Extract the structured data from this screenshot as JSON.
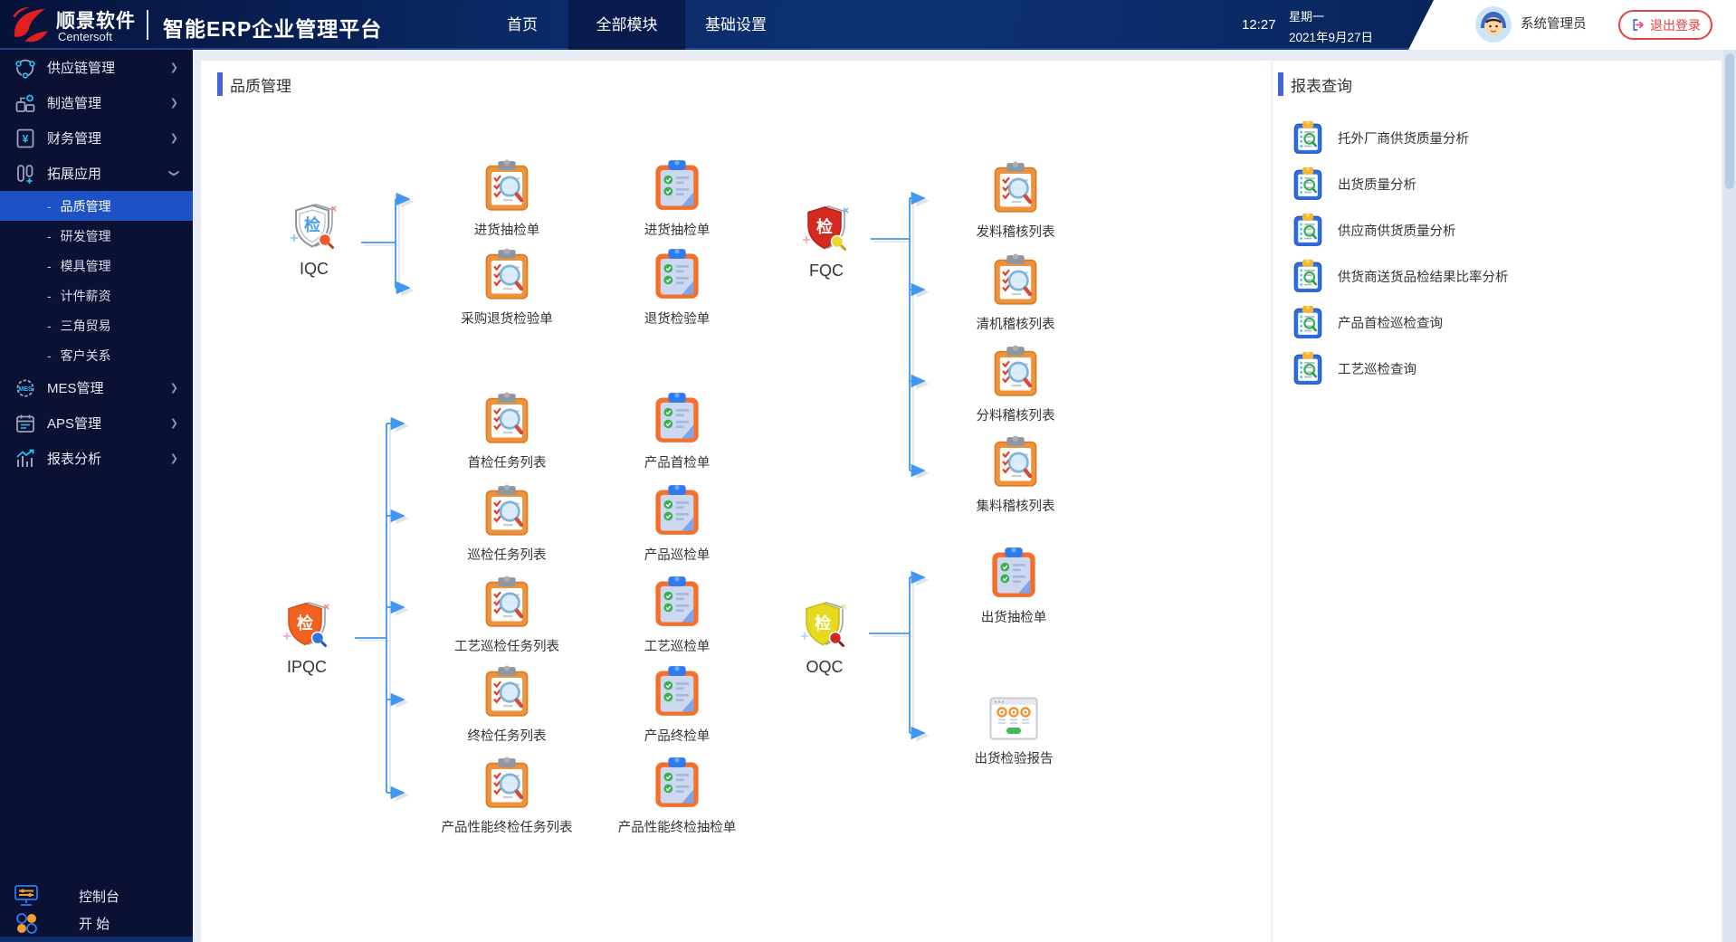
{
  "header": {
    "logo_title": "顺景软件",
    "logo_subtitle": "Centersoft",
    "app_title": "智能ERP企业管理平台",
    "nav": [
      {
        "label": "首页",
        "active": false
      },
      {
        "label": "全部模块",
        "active": true
      },
      {
        "label": "基础设置",
        "active": false
      }
    ],
    "time": "12:27",
    "weekday": "星期一",
    "date": "2021年9月27日",
    "user_name": "系统管理员",
    "logout_label": "退出登录"
  },
  "sidebar": {
    "groups_top": [
      {
        "label": "供应链管理",
        "icon": "supply-chain-icon"
      },
      {
        "label": "制造管理",
        "icon": "manufacturing-icon"
      },
      {
        "label": "财务管理",
        "icon": "finance-icon"
      },
      {
        "label": "拓展应用",
        "icon": "extended-apps-icon",
        "expanded": true
      }
    ],
    "submenu": [
      {
        "label": "品质管理",
        "active": true
      },
      {
        "label": "研发管理",
        "active": false
      },
      {
        "label": "模具管理",
        "active": false
      },
      {
        "label": "计件薪资",
        "active": false
      },
      {
        "label": "三角贸易",
        "active": false
      },
      {
        "label": "客户关系",
        "active": false
      }
    ],
    "groups_bottom": [
      {
        "label": "MES管理",
        "icon": "mes-icon"
      },
      {
        "label": "APS管理",
        "icon": "aps-icon"
      },
      {
        "label": "报表分析",
        "icon": "report-analysis-icon"
      }
    ],
    "footer": {
      "console": "控制台",
      "start": "开 始"
    }
  },
  "flowchart": {
    "title": "品质管理",
    "groups": [
      {
        "label": "IQC",
        "tasks": [
          "进货抽检单",
          "采购退货检验单"
        ],
        "forms": [
          "进货抽检单",
          "退货检验单"
        ]
      },
      {
        "label": "FQC",
        "tasks": [
          "发料稽核列表",
          "清机稽核列表",
          "分料稽核列表",
          "集料稽核列表"
        ],
        "forms": []
      },
      {
        "label": "IPQC",
        "tasks": [
          "首检任务列表",
          "巡检任务列表",
          "工艺巡检任务列表",
          "终检任务列表",
          "产品性能终检任务列表"
        ],
        "forms": [
          "产品首检单",
          "产品巡检单",
          "工艺巡检单",
          "产品终检单",
          "产品性能终检抽检单"
        ]
      },
      {
        "label": "OQC",
        "tasks": [],
        "forms": [
          "出货抽检单"
        ],
        "reports": [
          "出货检验报告"
        ]
      }
    ]
  },
  "reports": {
    "title": "报表查询",
    "items": [
      "托外厂商供货质量分析",
      "出货质量分析",
      "供应商供货质量分析",
      "供货商送货品检结果比率分析",
      "产品首检巡检查询",
      "工艺巡检查询"
    ]
  },
  "colors": {
    "accent": "#4663d6",
    "header_navy": "#0a2a66",
    "sidebar_bg": "#0b1133",
    "active_item": "#1d51c4",
    "arrow_blue": "#3f97f0",
    "logout_red": "#e84040",
    "shield_fqc": "#d42a20",
    "shield_ipqc": "#f2611f",
    "shield_oqc": "#e6da1e"
  }
}
